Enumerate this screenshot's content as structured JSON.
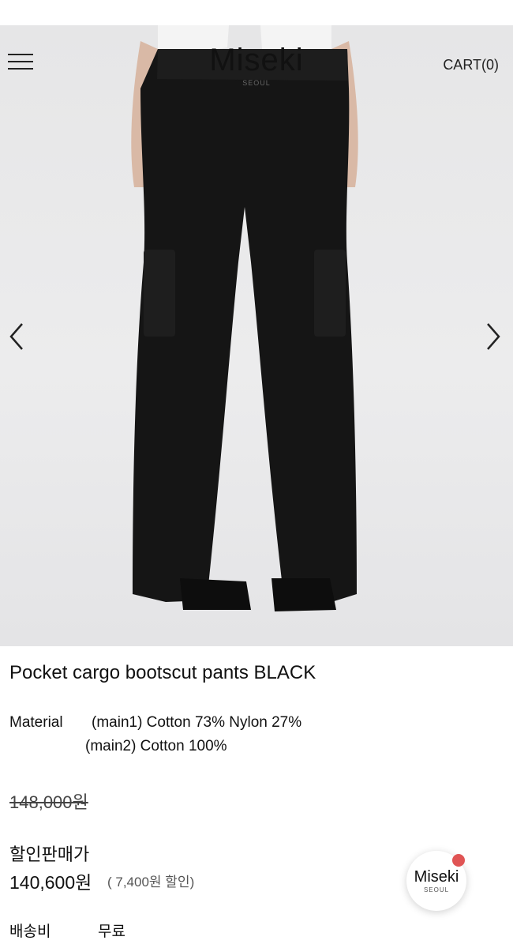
{
  "header": {
    "logo_main": "Miseki",
    "logo_sub": "SEOUL",
    "cart_label": "CART(0)"
  },
  "gallery": {
    "image_alt": "black pocket cargo bootscut pants worn on model",
    "icons": {
      "prev": "chevron-left-icon",
      "next": "chevron-right-icon",
      "menu": "hamburger-menu-icon"
    }
  },
  "product": {
    "title": "Pocket cargo bootscut pants BLACK",
    "material_label": "Material",
    "material_lines": [
      "(main1) Cotton 73% Nylon 27%",
      "(main2) Cotton 100%"
    ],
    "original_price": "148,000원",
    "sale_label": "할인판매가",
    "sale_price": "140,600원",
    "discount_text": "( 7,400원 할인)",
    "shipping_label": "배송비",
    "shipping_value": "무료"
  },
  "floating_badge": {
    "label": "Miseki",
    "sub": "SEOUL",
    "dot_color": "#e05454"
  }
}
